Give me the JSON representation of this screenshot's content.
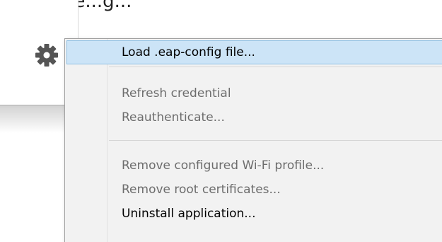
{
  "partial_text": "„ ... ...,pe...g...",
  "menu": {
    "items": [
      {
        "label": "Load .eap-config file...",
        "state": "highlighted"
      },
      {
        "label": "Refresh credential",
        "state": "disabled"
      },
      {
        "label": "Reauthenticate...",
        "state": "disabled"
      },
      {
        "label": "Remove configured Wi-Fi profile...",
        "state": "disabled"
      },
      {
        "label": "Remove root certificates...",
        "state": "disabled"
      },
      {
        "label": "Uninstall application...",
        "state": "enabled"
      }
    ]
  },
  "icons": {
    "settings": "gear-icon"
  },
  "colors": {
    "highlight_bg": "#cce4f7",
    "highlight_border": "#8fbfe3",
    "menu_bg": "#f2f2f2",
    "disabled_text": "#6d6d6d"
  }
}
